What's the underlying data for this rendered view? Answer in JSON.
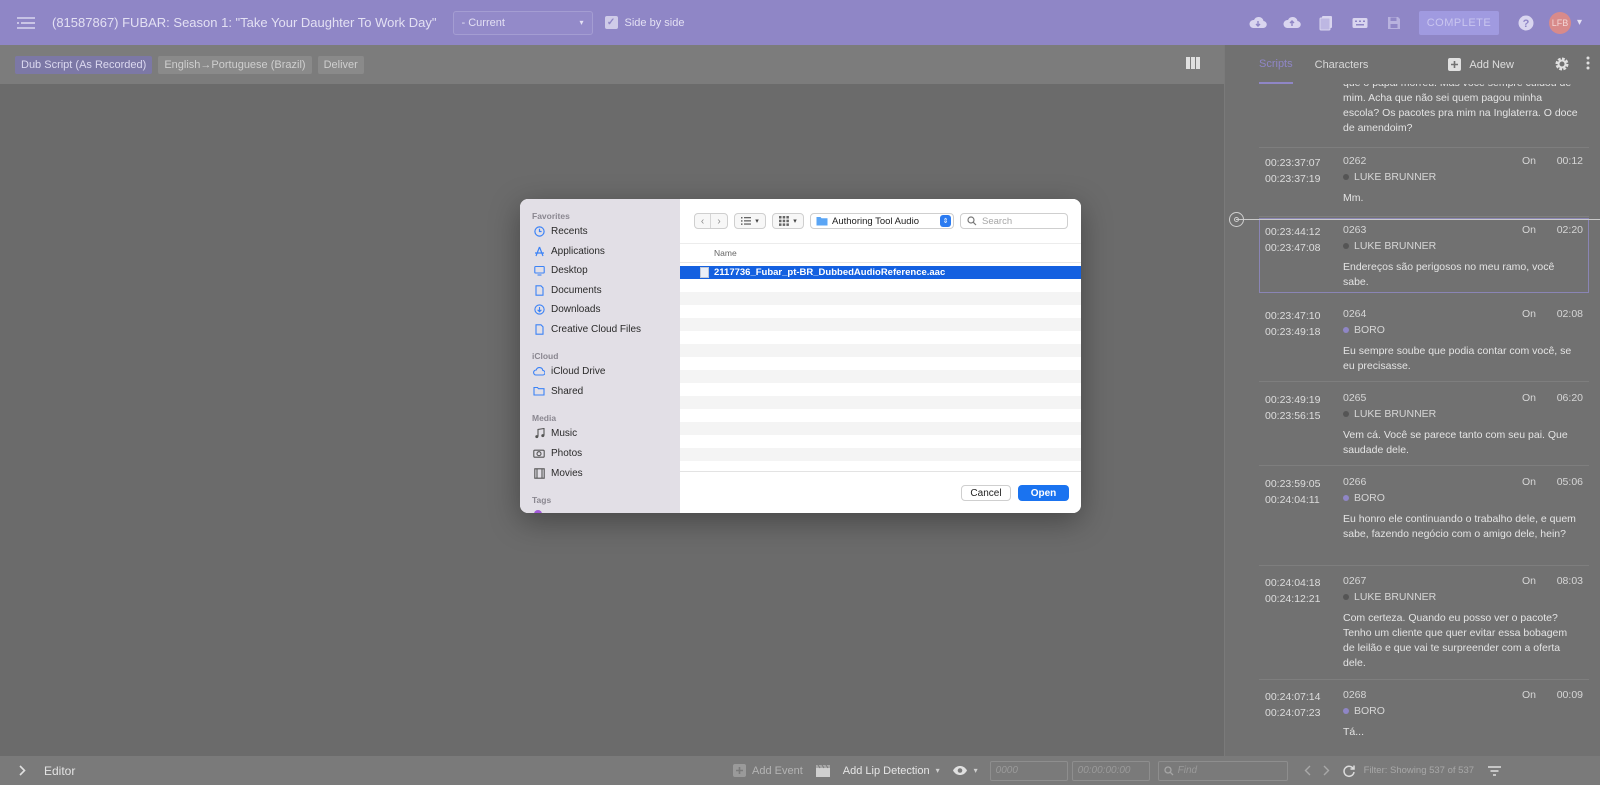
{
  "header": {
    "title": "(81587867) FUBAR: Season 1: \"Take Your Daughter To Work Day\"",
    "version_select": "- Current",
    "side_by_side_label": "Side by side",
    "complete_label": "COMPLETE",
    "avatar_initials": "LFB",
    "icons": [
      "download-icon",
      "upload-icon",
      "document-stack-icon",
      "keyboard-icon",
      "save-icon",
      "help-icon"
    ]
  },
  "subbar": {
    "crumbs": [
      "Dub Script (As Recorded)",
      "English→Portuguese (Brazil)",
      "Deliver"
    ]
  },
  "right_panel": {
    "tabs": [
      "Scripts",
      "Characters"
    ],
    "add_new_label": "Add New",
    "events": [
      {
        "line": "que o papai morreu. Mas você sempre cuidou de mim. Acha que não sei quem pagou minha escola? Os pacotes pra mim na Inglaterra. O doce de amendoim?"
      },
      {
        "tc_in": "00:23:37:07",
        "tc_out": "00:23:37:19",
        "number": "0262",
        "status": "On",
        "duration": "00:12",
        "character": "LUKE BRUNNER",
        "line": "Mm."
      },
      {
        "tc_in": "00:23:44:12",
        "tc_out": "00:23:47:08",
        "number": "0263",
        "status": "On",
        "duration": "02:20",
        "character": "LUKE BRUNNER",
        "line": "Endereços são perigosos no meu ramo, você sabe."
      },
      {
        "tc_in": "00:23:47:10",
        "tc_out": "00:23:49:18",
        "number": "0264",
        "status": "On",
        "duration": "02:08",
        "character": "BORO",
        "line": "Eu sempre soube que podia contar com você, se eu precisasse."
      },
      {
        "tc_in": "00:23:49:19",
        "tc_out": "00:23:56:15",
        "number": "0265",
        "status": "On",
        "duration": "06:20",
        "character": "LUKE BRUNNER",
        "line": "Vem cá. Você se parece tanto com seu pai. Que saudade dele."
      },
      {
        "tc_in": "00:23:59:05",
        "tc_out": "00:24:04:11",
        "number": "0266",
        "status": "On",
        "duration": "05:06",
        "character": "BORO",
        "line": "Eu honro ele continuando o trabalho dele, e quem sabe, fazendo negócio com o amigo dele, hein?"
      },
      {
        "tc_in": "00:24:04:18",
        "tc_out": "00:24:12:21",
        "number": "0267",
        "status": "On",
        "duration": "08:03",
        "character": "LUKE BRUNNER",
        "line": "Com certeza. Quando eu posso ver o pacote? Tenho um cliente que quer evitar essa bobagem de leilão e que vai te surpreender com a oferta dele."
      },
      {
        "tc_in": "00:24:07:14",
        "tc_out": "00:24:07:23",
        "number": "0268",
        "status": "On",
        "duration": "00:09",
        "character": "BORO",
        "line": "Tá..."
      }
    ]
  },
  "bottombar": {
    "editor_label": "Editor",
    "add_event_label": "Add Event",
    "add_lip_detection_label": "Add Lip Detection",
    "event_number_placeholder": "0000",
    "timecode_placeholder": "00:00:00:00",
    "find_placeholder": "Find",
    "filter_text": "Filter: Showing 537 of 537"
  },
  "dialog": {
    "sidebar": {
      "favorites_header": "Favorites",
      "favorites": [
        {
          "label": "Recents",
          "icon": "clock-icon"
        },
        {
          "label": "Applications",
          "icon": "applications-icon"
        },
        {
          "label": "Desktop",
          "icon": "desktop-icon"
        },
        {
          "label": "Documents",
          "icon": "document-icon"
        },
        {
          "label": "Downloads",
          "icon": "download-icon"
        },
        {
          "label": "Creative Cloud Files",
          "icon": "file-icon"
        }
      ],
      "icloud_header": "iCloud",
      "icloud": [
        {
          "label": "iCloud Drive",
          "icon": "cloud-icon"
        },
        {
          "label": "Shared",
          "icon": "shared-folder-icon"
        }
      ],
      "media_header": "Media",
      "media": [
        {
          "label": "Music",
          "icon": "music-icon"
        },
        {
          "label": "Photos",
          "icon": "camera-icon"
        },
        {
          "label": "Movies",
          "icon": "film-icon"
        }
      ],
      "tags_header": "Tags"
    },
    "location": "Authoring Tool Audio",
    "search_placeholder": "Search",
    "column_name": "Name",
    "selected_file": "2117736_Fubar_pt-BR_DubbedAudioReference.aac",
    "cancel_label": "Cancel",
    "open_label": "Open"
  }
}
